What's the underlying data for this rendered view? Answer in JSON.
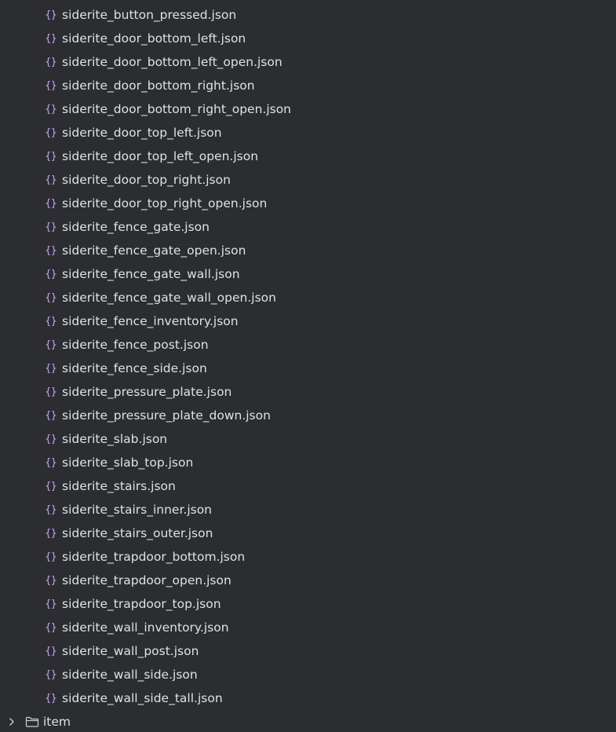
{
  "icons": {
    "file_icon": "json-braces-icon",
    "folder_icon": "folder-icon",
    "expand_icon": "chevron-right-icon"
  },
  "colors": {
    "background": "#2b2d30",
    "text": "#dfe1e5",
    "json_icon": "#c097e8",
    "folder_icon": "#ced0d6",
    "chevron": "#ced0d6"
  },
  "files": [
    {
      "name": "siderite_button_pressed.json"
    },
    {
      "name": "siderite_door_bottom_left.json"
    },
    {
      "name": "siderite_door_bottom_left_open.json"
    },
    {
      "name": "siderite_door_bottom_right.json"
    },
    {
      "name": "siderite_door_bottom_right_open.json"
    },
    {
      "name": "siderite_door_top_left.json"
    },
    {
      "name": "siderite_door_top_left_open.json"
    },
    {
      "name": "siderite_door_top_right.json"
    },
    {
      "name": "siderite_door_top_right_open.json"
    },
    {
      "name": "siderite_fence_gate.json"
    },
    {
      "name": "siderite_fence_gate_open.json"
    },
    {
      "name": "siderite_fence_gate_wall.json"
    },
    {
      "name": "siderite_fence_gate_wall_open.json"
    },
    {
      "name": "siderite_fence_inventory.json"
    },
    {
      "name": "siderite_fence_post.json"
    },
    {
      "name": "siderite_fence_side.json"
    },
    {
      "name": "siderite_pressure_plate.json"
    },
    {
      "name": "siderite_pressure_plate_down.json"
    },
    {
      "name": "siderite_slab.json"
    },
    {
      "name": "siderite_slab_top.json"
    },
    {
      "name": "siderite_stairs.json"
    },
    {
      "name": "siderite_stairs_inner.json"
    },
    {
      "name": "siderite_stairs_outer.json"
    },
    {
      "name": "siderite_trapdoor_bottom.json"
    },
    {
      "name": "siderite_trapdoor_open.json"
    },
    {
      "name": "siderite_trapdoor_top.json"
    },
    {
      "name": "siderite_wall_inventory.json"
    },
    {
      "name": "siderite_wall_post.json"
    },
    {
      "name": "siderite_wall_side.json"
    },
    {
      "name": "siderite_wall_side_tall.json"
    }
  ],
  "folder": {
    "name": "item",
    "expanded": false
  }
}
